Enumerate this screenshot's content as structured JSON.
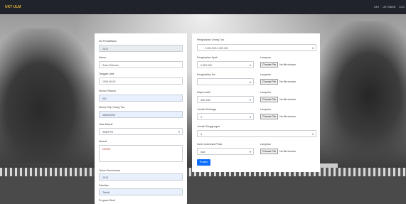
{
  "topbar": {
    "brand": "UKT ULM",
    "nav": [
      "UKT",
      "UKT BARU",
      "LOG"
    ]
  },
  "form_left": {
    "no_pendaftaran": {
      "label": "No Pendaftaran",
      "value": "2013"
    },
    "nama": {
      "label": "Nama",
      "value": "Sudo Rahman"
    },
    "tanggal_lahir": {
      "label": "Tanggal Lahir",
      "value": "1994-06-06"
    },
    "nomor_telepon": {
      "label": "Nomor Telepon",
      "value": "081"
    },
    "nomor_telp_ortu": {
      "label": "Nomor Telp Orang Tua",
      "value": "085000000"
    },
    "jalur_masuk": {
      "label": "Jalur Masuk",
      "value": "SBMPTN"
    },
    "alamat": {
      "label": "Alamat",
      "value": "DEKAT"
    },
    "tahun_penerimaan": {
      "label": "Tahun Penerimaan",
      "value": "2018"
    },
    "fakultas": {
      "label": "Fakultas",
      "value": "Teknik"
    },
    "program_studi": {
      "label": "Program Studi",
      "value": ""
    }
  },
  "form_right": {
    "penghasilan_ortu": {
      "label": "Penghasilan Orang Tua",
      "value": "2.000.000-3.000.000"
    },
    "penghasilan_ayah": {
      "label": "Penghasilan Ayah",
      "value": "2.500.000"
    },
    "penghasilan_ibu": {
      "label": "Penghasilan Ibu",
      "value": "-"
    },
    "daya_listrik": {
      "label": "Daya Listrik",
      "value": "450 watt"
    },
    "jumlah_keluarga": {
      "label": "Jumlah Keluarga",
      "value": "3"
    },
    "jumlah_tanggungan": {
      "label": "Jumlah Tanggungan",
      "value": "4"
    },
    "kartu_indonesia_pintar": {
      "label": "Kartu Indonesia Pintar",
      "value": "Ada"
    },
    "lampiran_label": "Lampiran",
    "choose_file": "Choose File",
    "no_file": "No file chosen",
    "submit": "Proses"
  }
}
